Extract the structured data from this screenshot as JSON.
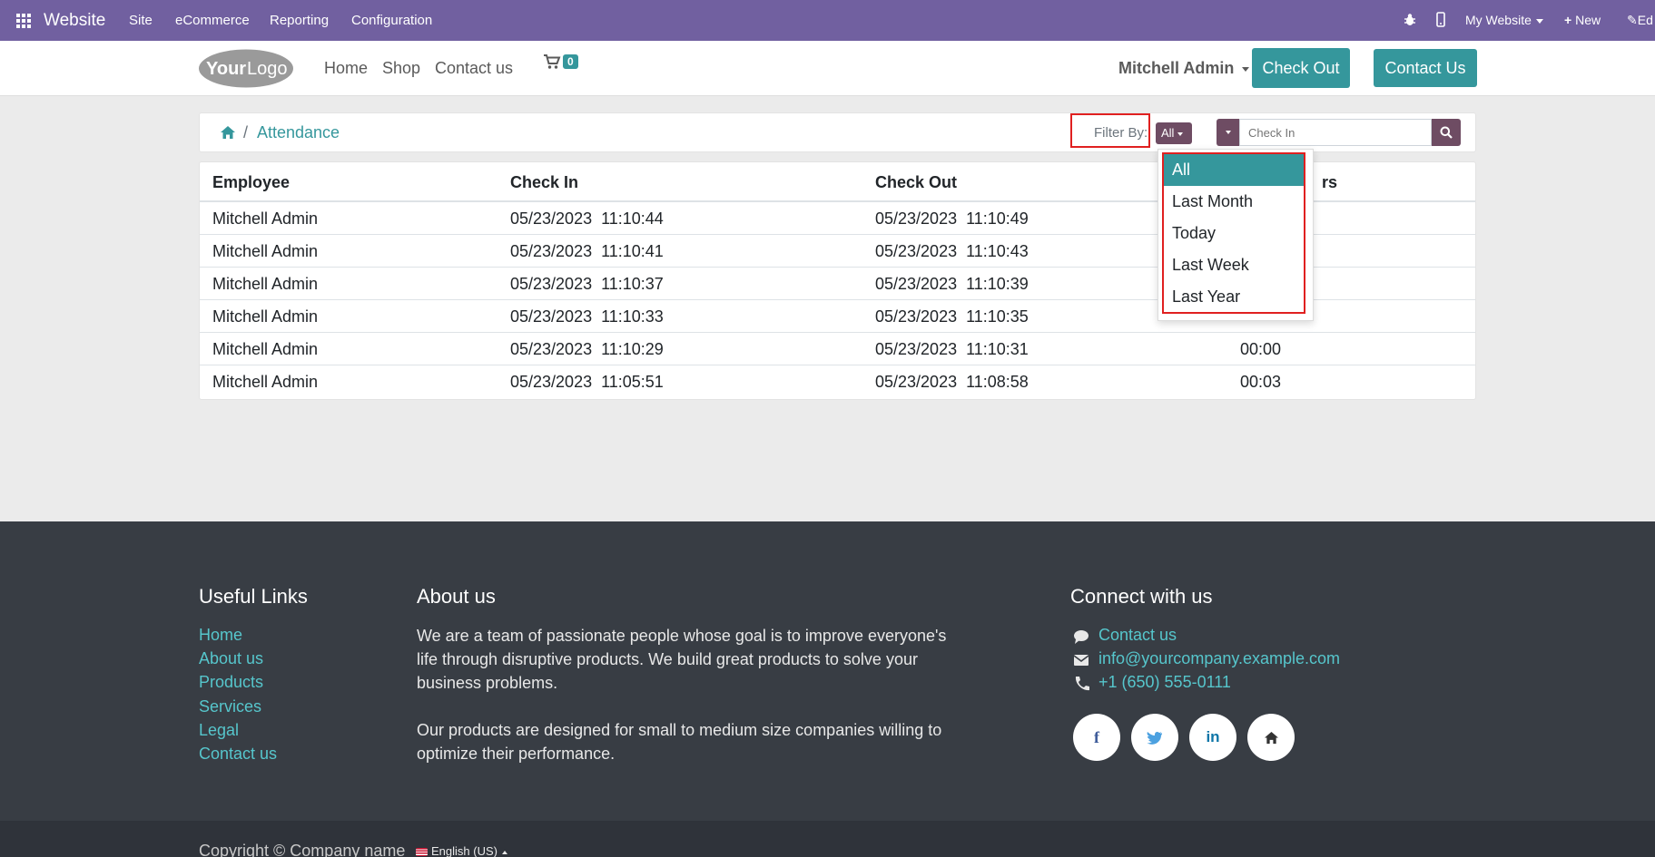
{
  "admin_bar": {
    "brand": "Website",
    "menus": [
      "Site",
      "eCommerce",
      "Reporting",
      "Configuration"
    ],
    "my_website": "My Website",
    "new_label": "New",
    "edit_label": "Ed"
  },
  "header": {
    "logo_text": "YourLogo",
    "nav": [
      "Home",
      "Shop",
      "Contact us"
    ],
    "cart_count": "0",
    "user": "Mitchell Admin",
    "check_out_label": "Check Out",
    "contact_us_label": "Contact Us"
  },
  "breadcrumb": {
    "current": "Attendance"
  },
  "filter": {
    "label": "Filter By:",
    "selected": "All",
    "options": [
      "All",
      "Last Month",
      "Today",
      "Last Week",
      "Last Year"
    ]
  },
  "search": {
    "placeholder": "Check In"
  },
  "table": {
    "columns": [
      "Employee",
      "Check In",
      "Check Out",
      "rs"
    ],
    "rows": [
      {
        "employee": "Mitchell Admin",
        "check_in": "05/23/2023  11:10:44",
        "check_out": "05/23/2023  11:10:49",
        "hours": ""
      },
      {
        "employee": "Mitchell Admin",
        "check_in": "05/23/2023  11:10:41",
        "check_out": "05/23/2023  11:10:43",
        "hours": ""
      },
      {
        "employee": "Mitchell Admin",
        "check_in": "05/23/2023  11:10:37",
        "check_out": "05/23/2023  11:10:39",
        "hours": ""
      },
      {
        "employee": "Mitchell Admin",
        "check_in": "05/23/2023  11:10:33",
        "check_out": "05/23/2023  11:10:35",
        "hours": ""
      },
      {
        "employee": "Mitchell Admin",
        "check_in": "05/23/2023  11:10:29",
        "check_out": "05/23/2023  11:10:31",
        "hours": "00:00"
      },
      {
        "employee": "Mitchell Admin",
        "check_in": "05/23/2023  11:05:51",
        "check_out": "05/23/2023  11:08:58",
        "hours": "00:03"
      }
    ]
  },
  "footer": {
    "useful_links_title": "Useful Links",
    "useful_links": [
      "Home",
      "About us",
      "Products",
      "Services",
      "Legal",
      "Contact us"
    ],
    "about_title": "About us",
    "about_lines_1": [
      "We are a team of passionate people whose goal is to improve everyone's",
      "life through disruptive products. We build great products to solve your",
      "business problems."
    ],
    "about_lines_2": [
      "Our products are designed for small to medium size companies willing to",
      "optimize their performance."
    ],
    "connect_title": "Connect with us",
    "contact_link": "Contact us",
    "email": "info@yourcompany.example.com",
    "phone": "+1 (650) 555-0111",
    "copyright": "Copyright © Company name",
    "language": "English (US)"
  },
  "colors": {
    "admin_bar": "#7160a0",
    "accent": "#35979c",
    "filter_button": "#6e4c63",
    "footer_bg": "#383d44",
    "highlight_box": "#e02020"
  }
}
